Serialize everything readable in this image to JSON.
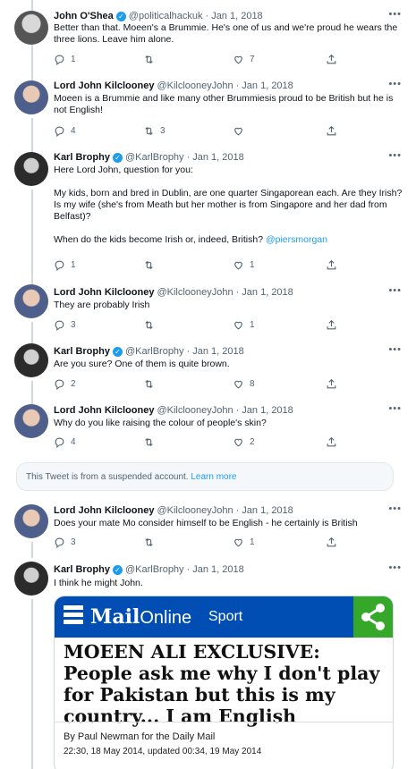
{
  "tweets": [
    {
      "name": "John O'Shea",
      "verified": true,
      "handle": "@politicalhackuk",
      "date": "Jan 1, 2018",
      "text": "Better than that. Moeen's a Brummie. He's one of us and we're proud he wears the three lions. Leave him alone.",
      "replies": "1",
      "retweets": "",
      "likes": "7"
    },
    {
      "name": "Lord John Kilclooney",
      "verified": false,
      "handle": "@KilclooneyJohn",
      "date": "Jan 1, 2018",
      "text": "Moeen is a Brummie and like many other Brummiesis proud to be British but he is not English!",
      "replies": "4",
      "retweets": "3",
      "likes": ""
    },
    {
      "name": "Karl Brophy",
      "verified": true,
      "handle": "@KarlBrophy",
      "date": "Jan 1, 2018",
      "text": "Here Lord John, question for you:\n\nMy kids, born and bred in Dublin, are one quarter Singaporean each.  Are they Irish?  Is my wife (she's from Meath but her mother is from Singapore and her dad from Belfast)?\n\nWhen do the kids become Irish or, indeed, British?",
      "mention": "@piersmorgan",
      "replies": "1",
      "retweets": "",
      "likes": "1"
    },
    {
      "name": "Lord John Kilclooney",
      "verified": false,
      "handle": "@KilclooneyJohn",
      "date": "Jan 1, 2018",
      "text": "They are probably Irish",
      "replies": "3",
      "retweets": "",
      "likes": "1"
    },
    {
      "name": "Karl Brophy",
      "verified": true,
      "handle": "@KarlBrophy",
      "date": "Jan 1, 2018",
      "text": "Are you sure?  One of them is quite brown.",
      "replies": "2",
      "retweets": "",
      "likes": "8"
    },
    {
      "name": "Lord John Kilclooney",
      "verified": false,
      "handle": "@KilclooneyJohn",
      "date": "Jan 1, 2018",
      "text": "Why do you like raising the colour of people's skin?",
      "replies": "4",
      "retweets": "",
      "likes": "2"
    },
    {
      "name": "Lord John Kilclooney",
      "verified": false,
      "handle": "@KilclooneyJohn",
      "date": "Jan 1, 2018",
      "text": "Does your mate Mo consider himself to be English - he certainly is British",
      "replies": "3",
      "retweets": "",
      "likes": "1"
    },
    {
      "name": "Karl Brophy",
      "verified": true,
      "handle": "@KarlBrophy",
      "date": "Jan 1, 2018",
      "text": "I think he might John."
    }
  ],
  "suspended": {
    "text": "This Tweet is from a suspended account.",
    "link": "Learn more"
  },
  "card": {
    "brand_mail": "Mail",
    "brand_online": "Online",
    "section": "Sport",
    "headline": "MOEEN ALI EXCLUSIVE: People ask me why I don't play for Pakistan but this is my country... I am English",
    "byline": "By Paul Newman for the Daily Mail",
    "timestamp": "22:30, 18 May 2014, updated 00:34, 19 May 2014"
  },
  "more_glyph": "•••",
  "verified_glyph": "✓",
  "colors": {
    "link": "#1d9bf0",
    "muted": "#536471",
    "mail_blue": "#004db3",
    "share_green": "#35a829"
  },
  "icons": [
    "reply-icon",
    "retweet-icon",
    "like-icon",
    "share-icon",
    "more-icon",
    "verified-badge-icon"
  ]
}
